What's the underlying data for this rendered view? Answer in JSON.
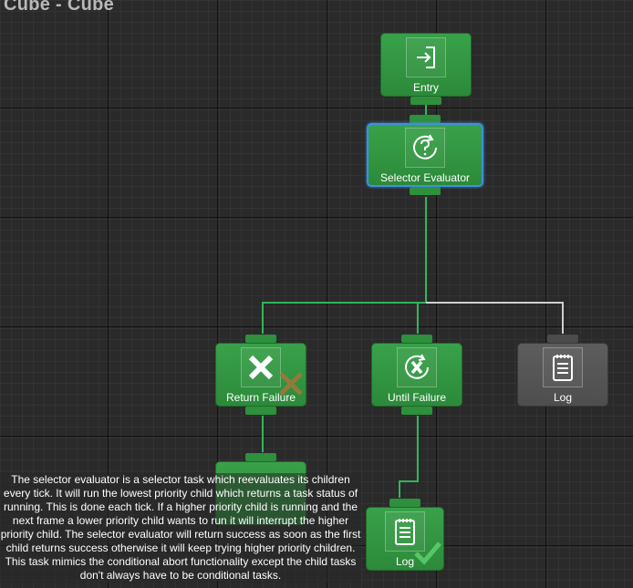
{
  "graph_title": "Cube - Cube",
  "nodes": {
    "entry": {
      "label": "Entry",
      "icon": "entry-arrow-icon"
    },
    "selector_evaluator": {
      "label": "Selector Evaluator",
      "icon": "question-refresh-icon",
      "selected": true
    },
    "return_failure": {
      "label": "Return Failure",
      "icon": "x-icon",
      "status": "failure-x"
    },
    "until_failure": {
      "label": "Until Failure",
      "icon": "x-refresh-icon"
    },
    "log_disabled": {
      "label": "Log",
      "icon": "notepad-icon",
      "disabled": true
    },
    "log_success": {
      "label": "Log",
      "icon": "notepad-icon",
      "status": "success-check"
    }
  },
  "description": "The selector evaluator is a selector task which reevaluates its children every tick. It will run the lowest priority child which returns a task status of running. This is done each tick. If a higher priority child is running and the next frame a lower priority child wants to run it will interrupt the higher priority child. The selector evaluator will return success as soon as the first child returns success otherwise it will keep trying higher priority children. This task mimics the conditional abort functionality except the child tasks don't always have to be conditional tasks.",
  "colors": {
    "active_node": "#35994a",
    "disabled_node": "#575757",
    "selected_outline": "#3e8fe0",
    "active_edge": "#2fb65a",
    "inactive_edge": "#cfcfcf"
  }
}
